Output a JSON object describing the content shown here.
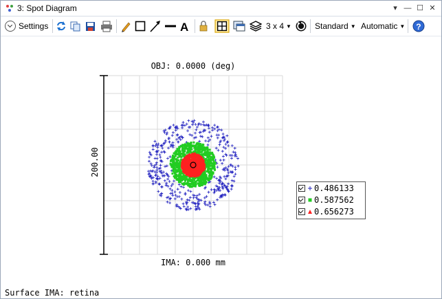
{
  "window": {
    "title": "3: Spot Diagram",
    "controls": [
      "▾",
      "—",
      "☐",
      "✕"
    ]
  },
  "toolbar": {
    "settings_label": "Settings",
    "layout_label": "3 x 4",
    "standard_label": "Standard",
    "automatic_label": "Automatic"
  },
  "plot": {
    "obj_label": "OBJ: 0.0000 (deg)",
    "ima_label": "IMA: 0.000 mm",
    "scale_label": "200.00",
    "surface_label": "Surface IMA: retina"
  },
  "legend": {
    "items": [
      {
        "label": "0.486133",
        "color": "#1f1fbf",
        "marker": "plus"
      },
      {
        "label": "0.587562",
        "color": "#22cc22",
        "marker": "square"
      },
      {
        "label": "0.656273",
        "color": "#ff2020",
        "marker": "triangle"
      }
    ]
  },
  "colors": {
    "blue": "#1f1fbf",
    "green": "#22cc22",
    "red": "#ff2020",
    "grid": "#d9d9d9"
  }
}
